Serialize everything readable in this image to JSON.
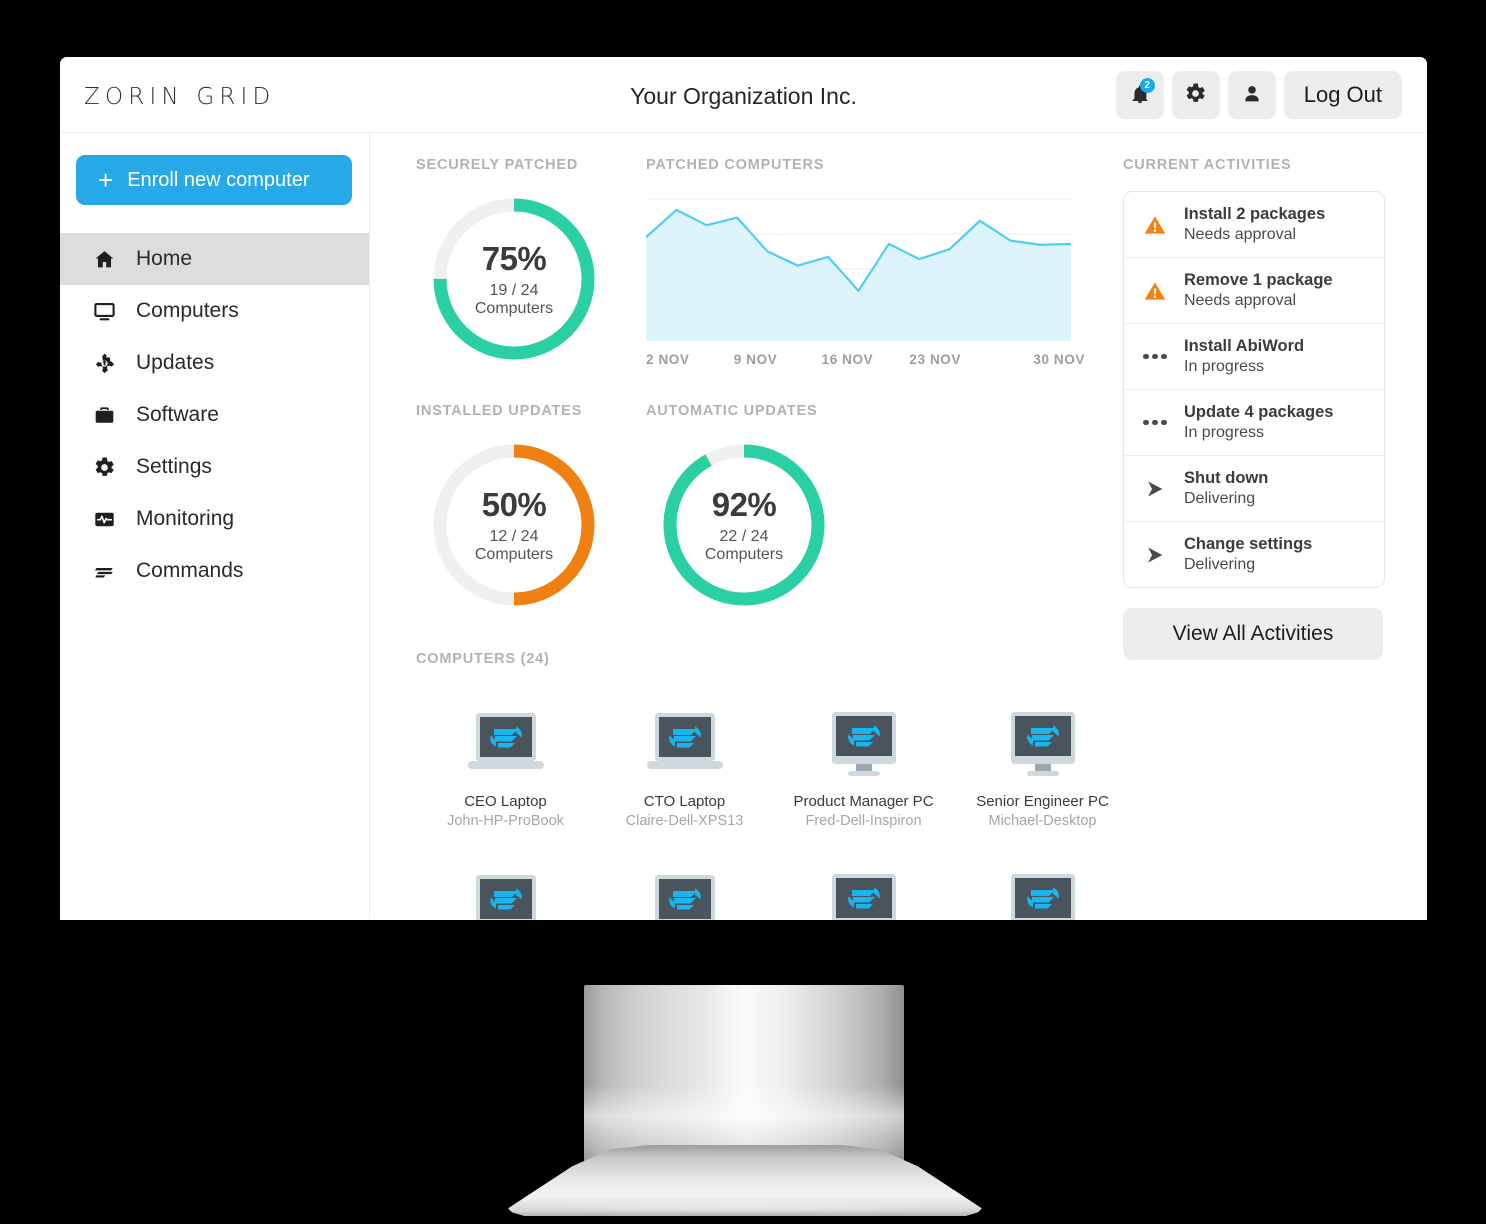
{
  "brand": {
    "logo_text": "ZORIN GRID",
    "accent_blue": "#27a9e8",
    "accent_teal": "#2bcfa4",
    "accent_orange": "#f08011"
  },
  "header": {
    "org_title": "Your Organization Inc.",
    "notifications_badge": "2",
    "logout_label": "Log Out",
    "icons": [
      "bell-icon",
      "gear-icon",
      "user-icon"
    ]
  },
  "sidebar": {
    "enroll_label": "Enroll new computer",
    "enroll_plus": "+",
    "items": [
      {
        "label": "Home",
        "icon": "home-icon",
        "active": true
      },
      {
        "label": "Computers",
        "icon": "monitor-icon",
        "active": false
      },
      {
        "label": "Updates",
        "icon": "update-icon",
        "active": false
      },
      {
        "label": "Software",
        "icon": "briefcase-icon",
        "active": false
      },
      {
        "label": "Settings",
        "icon": "gear-icon",
        "active": false
      },
      {
        "label": "Monitoring",
        "icon": "pulse-icon",
        "active": false
      },
      {
        "label": "Commands",
        "icon": "commands-icon",
        "active": false
      }
    ]
  },
  "stats": {
    "securely_patched": {
      "label": "SECURELY PATCHED",
      "percent": "75%",
      "percent_value": 75,
      "fraction": "19 / 24",
      "unit": "Computers",
      "color": "#2bcfa4"
    },
    "installed_updates": {
      "label": "INSTALLED UPDATES",
      "percent": "50%",
      "percent_value": 50,
      "fraction": "12 / 24",
      "unit": "Computers",
      "color": "#f08011"
    },
    "automatic_updates": {
      "label": "AUTOMATIC UPDATES",
      "percent": "92%",
      "percent_value": 92,
      "fraction": "22 / 24",
      "unit": "Computers",
      "color": "#2bcfa4"
    }
  },
  "chart_data": {
    "type": "area",
    "title": "PATCHED COMPUTERS",
    "xlabel": "",
    "ylabel": "",
    "tick_labels": [
      "2 NOV",
      "9 NOV",
      "16 NOV",
      "23 NOV",
      "30 NOV"
    ],
    "x": [
      1,
      2,
      3,
      4,
      5,
      6,
      7,
      8,
      9,
      10,
      11,
      12,
      13,
      14,
      15
    ],
    "values": [
      17.5,
      20.0,
      18.6,
      19.3,
      16.2,
      14.9,
      15.7,
      12.6,
      16.9,
      15.5,
      16.4,
      19.0,
      17.2,
      16.8,
      16.9
    ],
    "ylim": [
      8,
      21
    ],
    "grid": true,
    "legend": "none",
    "line_color": "#4ecdf5",
    "fill_color": "#ddf4fc"
  },
  "computers": {
    "label": "COMPUTERS (24)",
    "count": 24,
    "items": [
      {
        "name": "CEO Laptop",
        "host": "John-HP-ProBook",
        "type": "laptop"
      },
      {
        "name": "CTO Laptop",
        "host": "Claire-Dell-XPS13",
        "type": "laptop"
      },
      {
        "name": "Product Manager PC",
        "host": "Fred-Dell-Inspiron",
        "type": "desktop"
      },
      {
        "name": "Senior Engineer PC",
        "host": "Michael-Desktop",
        "type": "desktop"
      },
      {
        "name": "",
        "host": "",
        "type": "laptop"
      },
      {
        "name": "",
        "host": "",
        "type": "laptop"
      },
      {
        "name": "",
        "host": "",
        "type": "desktop"
      },
      {
        "name": "",
        "host": "",
        "type": "desktop"
      }
    ]
  },
  "activities": {
    "label": "CURRENT ACTIVITIES",
    "view_all_label": "View All Activities",
    "items": [
      {
        "title": "Install 2 packages",
        "status": "Needs approval",
        "icon": "warning-icon"
      },
      {
        "title": "Remove 1 package",
        "status": "Needs approval",
        "icon": "warning-icon"
      },
      {
        "title": "Install AbiWord",
        "status": "In progress",
        "icon": "ellipsis-icon"
      },
      {
        "title": "Update 4 packages",
        "status": "In progress",
        "icon": "ellipsis-icon"
      },
      {
        "title": "Shut down",
        "status": "Delivering",
        "icon": "play-icon"
      },
      {
        "title": "Change settings",
        "status": "Delivering",
        "icon": "play-icon"
      }
    ]
  }
}
